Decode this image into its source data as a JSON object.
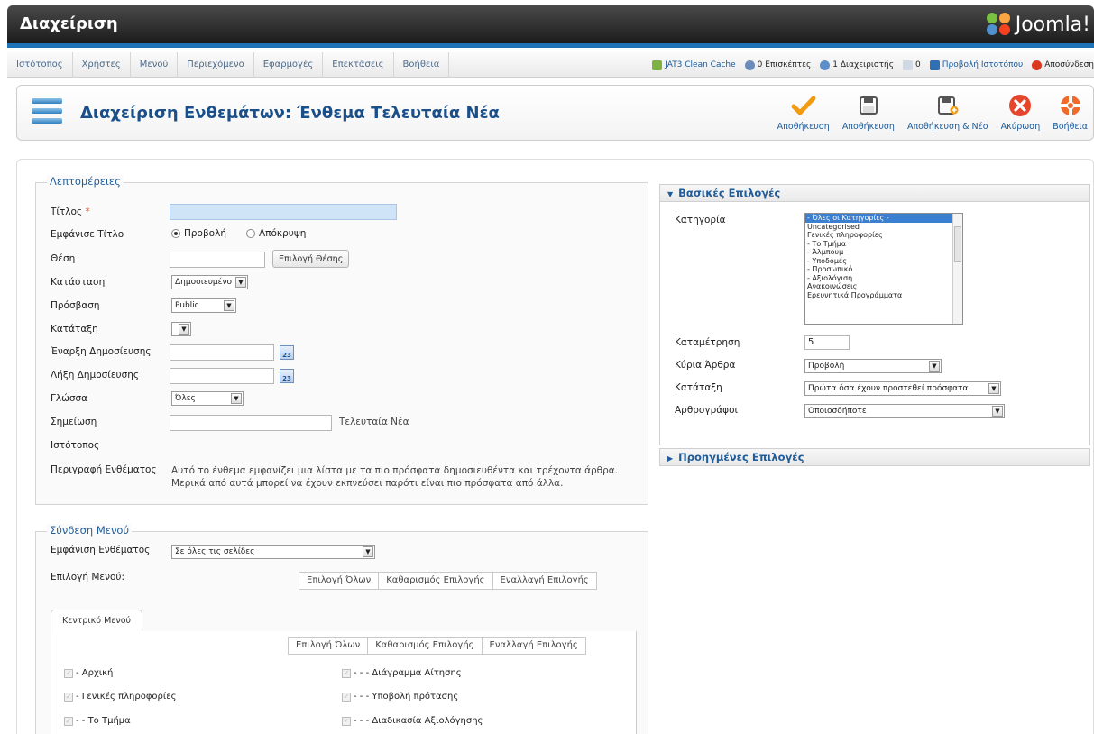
{
  "header": {
    "title": "Διαχείριση",
    "logo_text": "Joomla!"
  },
  "main_menu": [
    "Ιστότοπος",
    "Χρήστες",
    "Μενού",
    "Περιεχόμενο",
    "Εφαρμογές",
    "Επεκτάσεις",
    "Βοήθεια"
  ],
  "status": {
    "cache": "JAT3 Clean Cache",
    "visitors": "0 Επισκέπτες",
    "admins": "1 Διαχειριστής",
    "messages": "0",
    "view_site": "Προβολή Ιστοτόπου",
    "logout": "Αποσύνδεση"
  },
  "page_title": "Διαχείριση Ενθεμάτων: Ένθεμα Τελευταία Νέα",
  "toolbar": {
    "apply": "Αποθήκευση",
    "save": "Αποθήκευση",
    "save_new": "Αποθήκευση & Νέο",
    "cancel": "Ακύρωση",
    "help": "Βοήθεια"
  },
  "details": {
    "legend": "Λεπτομέρειες",
    "title_label": "Τίτλος",
    "required_mark": "*",
    "title_value": "",
    "show_title_label": "Εμφάνισε Τίτλο",
    "show_option": "Προβολή",
    "hide_option": "Απόκρυψη",
    "position_label": "Θέση",
    "position_value": "",
    "position_button": "Επιλογή Θέσης",
    "state_label": "Κατάσταση",
    "state_value": "Δημοσιευμένο",
    "access_label": "Πρόσβαση",
    "access_value": "Public",
    "ordering_label": "Κατάταξη",
    "ordering_value": "",
    "publish_up_label": "Έναρξη Δημοσίευσης",
    "publish_down_label": "Λήξη Δημοσίευσης",
    "calendar_day": "23",
    "language_label": "Γλώσσα",
    "language_value": "Όλες",
    "note_label": "Σημείωση",
    "note_value": "",
    "module_type": "Τελευταία Νέα",
    "site_label": "Ιστότοπος",
    "description_label": "Περιγραφή Ενθέματος",
    "description_line1": "Αυτό το ένθεμα εμφανίζει μια λίστα με τα πιο πρόσφατα δημοσιευθέντα και τρέχοντα άρθρα.",
    "description_line2": "Μερικά από αυτά μπορεί να έχουν εκπνεύσει παρότι είναι πιο πρόσφατα από άλλα."
  },
  "basic_options": {
    "header": "Βασικές Επιλογές",
    "category_label": "Κατηγορία",
    "categories": [
      "- Όλες οι Κατηγορίες -",
      "Uncategorised",
      "Γενικές πληροφορίες",
      "- Το Τμήμα",
      "- Άλμπουμ",
      "- Υποδομές",
      "- Προσωπικό",
      "- Αξιολόγιση",
      "Ανακοινώσεις",
      "Ερευνητικά Προγράμματα"
    ],
    "count_label": "Καταμέτρηση",
    "count_value": "5",
    "featured_label": "Κύρια Άρθρα",
    "featured_value": "Προβολή",
    "ordering_label": "Κατάταξη",
    "ordering_value": "Πρώτα όσα έχουν προστεθεί πρόσφατα",
    "authors_label": "Αρθρογράφοι",
    "authors_value": "Οποιοσδήποτε"
  },
  "advanced_options": {
    "header": "Προηγμένες Επιλογές"
  },
  "menu_assignment": {
    "legend": "Σύνδεση Μενού",
    "display_label": "Εμφάνιση Ενθέματος",
    "display_value": "Σε όλες τις σελίδες",
    "menu_select_label": "Επιλογή Μενού:",
    "select_all": "Επιλογή Όλων",
    "clear_selection": "Καθαρισμός Επιλογής",
    "toggle_selection": "Εναλλαγή Επιλογής",
    "tab": "Κεντρικό Μενού",
    "items_left": [
      "- Αρχική",
      "- Γενικές πληροφορίες",
      "- - Το Τμήμα"
    ],
    "items_right": [
      "- - - Διάγραμμα Αίτησης",
      "- - - Υποβολή πρότασης",
      "- - - Διαδικασία Αξιολόγησης"
    ]
  },
  "colors": {
    "brand_blue": "#1d73b8",
    "title_blue": "#1a4f8a",
    "legend_blue": "#1f5c99",
    "cancel_red": "#e5452a",
    "save_orange": "#f29b11"
  }
}
